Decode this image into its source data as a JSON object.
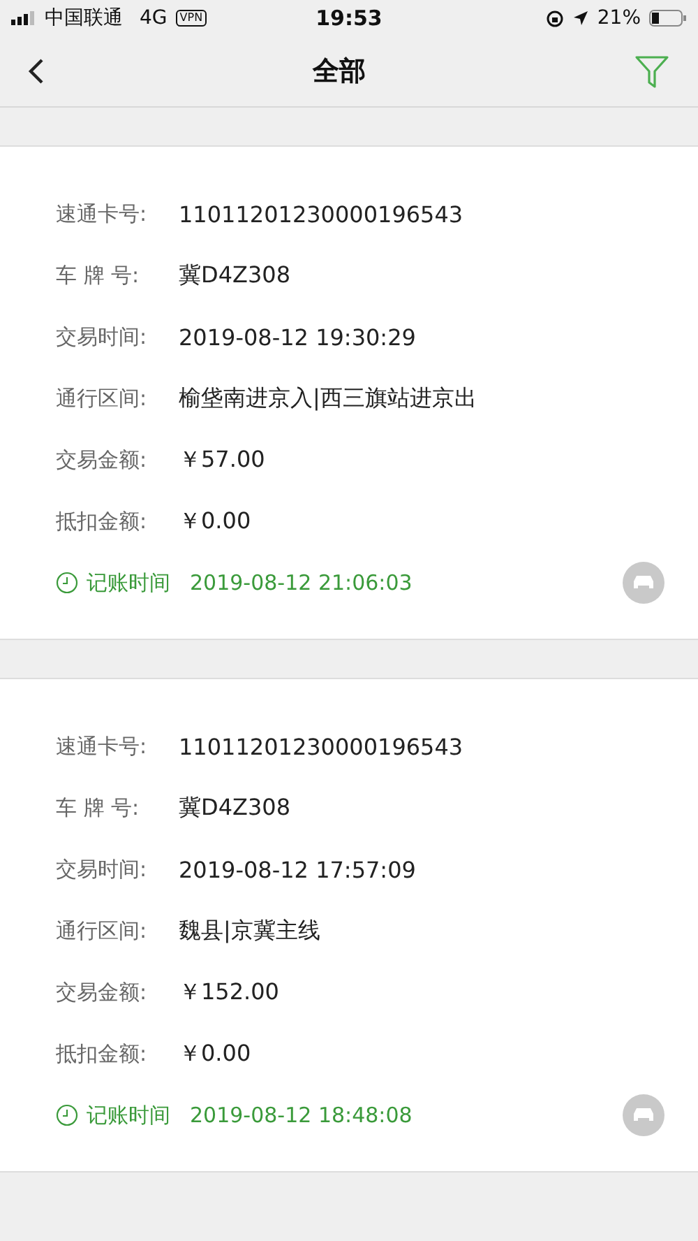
{
  "status_bar": {
    "carrier": "中国联通",
    "network": "4G",
    "vpn": "VPN",
    "time": "19:53",
    "battery": "21%"
  },
  "nav": {
    "title": "全部"
  },
  "records": [
    {
      "fields": [
        {
          "label": "速通卡号:",
          "value": "11011201230000196543"
        },
        {
          "label": "车 牌 号:",
          "value": "冀D4Z308"
        },
        {
          "label": "交易时间:",
          "value": "2019-08-12 19:30:29"
        },
        {
          "label": "通行区间:",
          "value": "榆垡南进京入|西三旗站进京出"
        },
        {
          "label": "交易金额:",
          "value": "￥57.00"
        },
        {
          "label": "抵扣金额:",
          "value": "￥0.00"
        }
      ],
      "posted_label": "记账时间",
      "posted_time": "2019-08-12 21:06:03"
    },
    {
      "fields": [
        {
          "label": "速通卡号:",
          "value": "11011201230000196543"
        },
        {
          "label": "车 牌 号:",
          "value": "冀D4Z308"
        },
        {
          "label": "交易时间:",
          "value": "2019-08-12 17:57:09"
        },
        {
          "label": "通行区间:",
          "value": "魏县|京冀主线"
        },
        {
          "label": "交易金额:",
          "value": "￥152.00"
        },
        {
          "label": "抵扣金额:",
          "value": "￥0.00"
        }
      ],
      "posted_label": "记账时间",
      "posted_time": "2019-08-12 18:48:08"
    }
  ]
}
